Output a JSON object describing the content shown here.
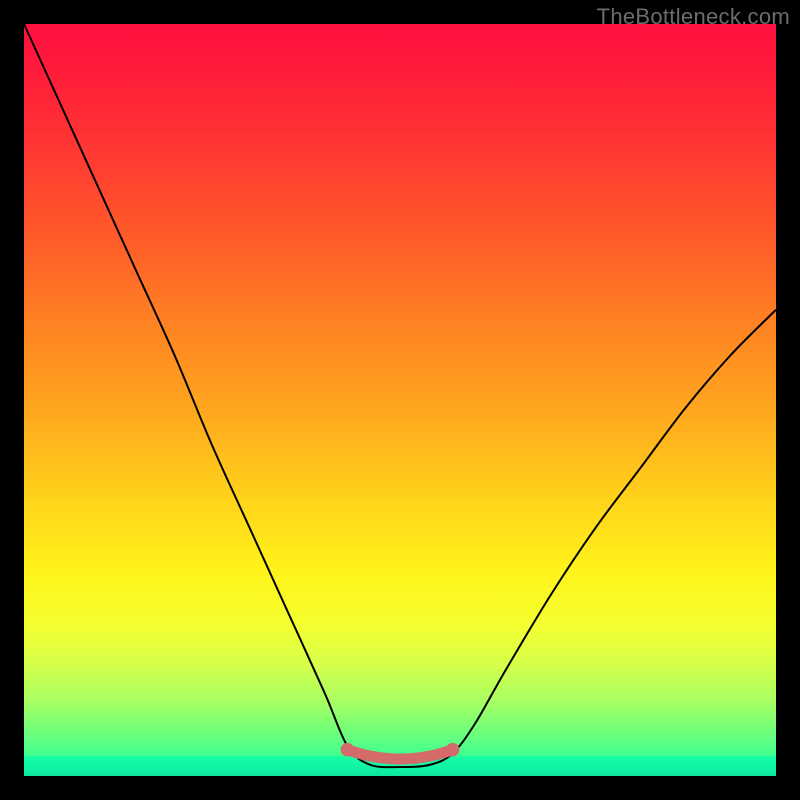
{
  "watermark": "TheBottleneck.com",
  "chart_data": {
    "type": "line",
    "title": "",
    "xlabel": "",
    "ylabel": "",
    "xlim": [
      0,
      100
    ],
    "ylim": [
      0,
      100
    ],
    "series": [
      {
        "name": "bottleneck-curve",
        "x": [
          0,
          5,
          10,
          15,
          20,
          25,
          30,
          35,
          40,
          43,
          46,
          50,
          54,
          57,
          60,
          64,
          70,
          76,
          82,
          88,
          94,
          100
        ],
        "values": [
          100,
          89,
          78,
          67,
          56,
          44,
          33,
          22,
          11,
          4,
          1.5,
          1.2,
          1.5,
          3,
          7,
          14,
          24,
          33,
          41,
          49,
          56,
          62
        ]
      }
    ],
    "highlight": {
      "name": "optimal-zone",
      "x_start": 43,
      "x_end": 57,
      "y": 1.5,
      "color": "#d46a6a"
    },
    "gradient_stops": [
      {
        "pct": 0,
        "color": "#ff1040"
      },
      {
        "pct": 16,
        "color": "#ff3533"
      },
      {
        "pct": 40,
        "color": "#ff8323"
      },
      {
        "pct": 63,
        "color": "#ffd21a"
      },
      {
        "pct": 80,
        "color": "#f4ff30"
      },
      {
        "pct": 100,
        "color": "#18ffa0"
      }
    ]
  }
}
